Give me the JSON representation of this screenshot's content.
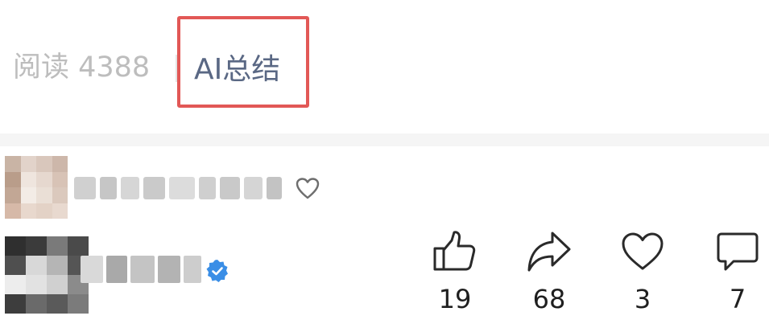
{
  "stats": {
    "read_label": "阅读 4388",
    "ai_summary_label": "AI总结"
  },
  "colors": {
    "highlight_border": "#e25856",
    "ai_summary_text": "#5a6884",
    "muted_text": "#bdbdbd",
    "verified_badge": "#3a8ee6"
  },
  "comments": [
    {
      "avatar": "avatar-pixelated",
      "text": "blurred-comment-text",
      "action_icon": "heart-icon"
    },
    {
      "avatar": "avatar-pixelated",
      "name": "blurred-username",
      "badge": "verified-badge-icon"
    }
  ],
  "actions": [
    {
      "icon": "thumbs-up-icon",
      "count": "19"
    },
    {
      "icon": "share-icon",
      "count": "68"
    },
    {
      "icon": "heart-icon",
      "count": "3"
    },
    {
      "icon": "comment-icon",
      "count": "7"
    }
  ]
}
